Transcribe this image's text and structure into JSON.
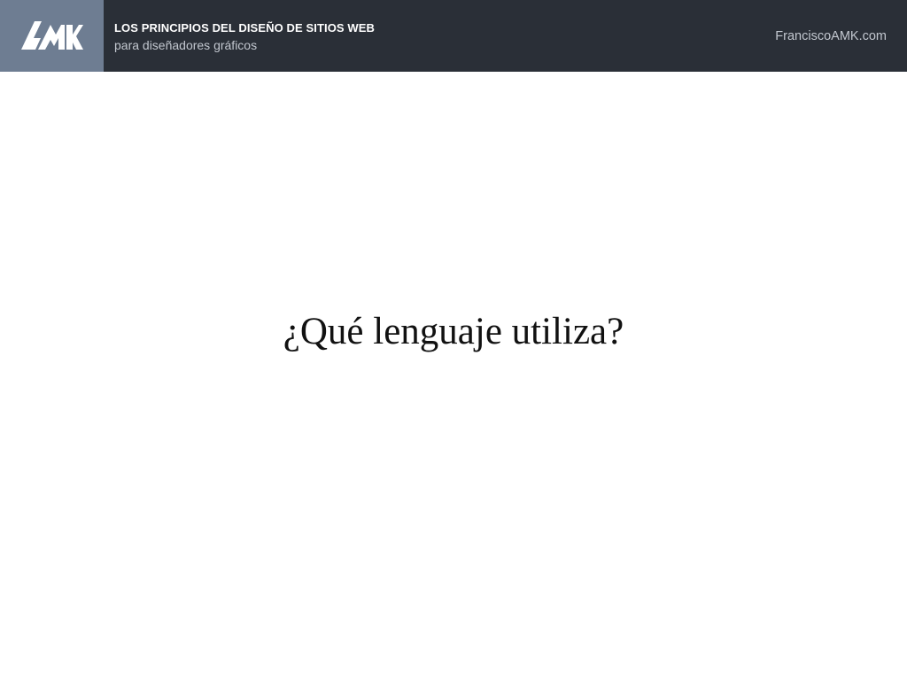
{
  "header": {
    "logo": {
      "text": "AMK",
      "icon": "amk-logo-icon",
      "background_color": "#6e7d92"
    },
    "title": "LOS PRINCIPIOS DEL DISEÑO DE SITIOS WEB",
    "subtitle": "para diseñadores gráficos",
    "site": "FranciscoAMK.com",
    "background_color": "#2a2f37"
  },
  "slide": {
    "question": "¿Qué lenguaje utiliza?"
  }
}
